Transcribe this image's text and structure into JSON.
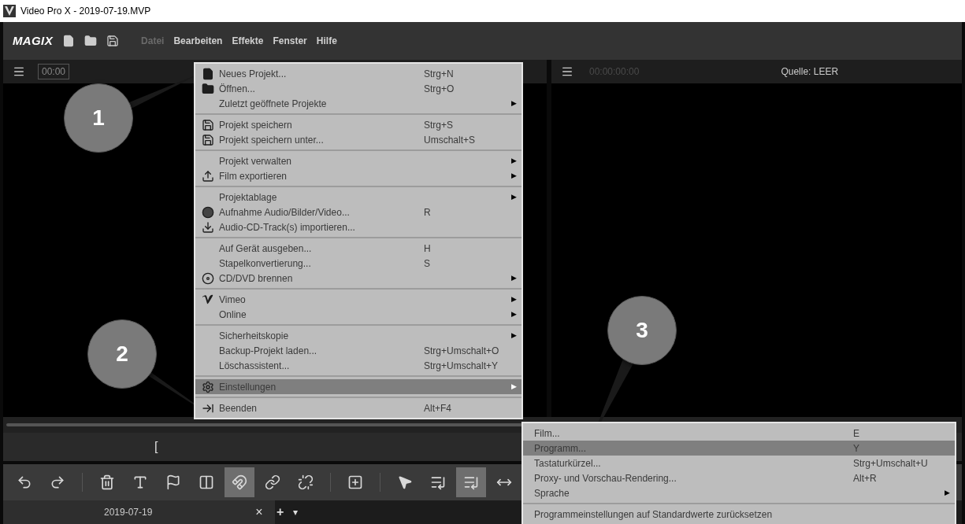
{
  "window": {
    "title": "Video Pro X - 2019-07-19.MVP"
  },
  "app_bar": {
    "logo": "MAGIX",
    "menus": [
      {
        "label": "Datei",
        "selected": true
      },
      {
        "label": "Bearbeiten",
        "selected": false
      },
      {
        "label": "Effekte",
        "selected": false
      },
      {
        "label": "Fenster",
        "selected": false
      },
      {
        "label": "Hilfe",
        "selected": false
      }
    ]
  },
  "left_monitor": {
    "timecode": "00:00"
  },
  "right_monitor": {
    "timecode": "00:00:00:00",
    "source": "Quelle: LEER"
  },
  "in_marker": "[",
  "file_menu": [
    [
      {
        "kind": "file",
        "label": "Neues Projekt...",
        "shortcut": "Strg+N",
        "selected": false
      },
      {
        "kind": "folder",
        "label": "Öffnen...",
        "shortcut": "Strg+O",
        "selected": false
      },
      {
        "kind": "plain",
        "label": "Zuletzt geöffnete Projekte",
        "arrow": "▶",
        "selected": false
      }
    ],
    [
      {
        "kind": "save",
        "label": "Projekt speichern",
        "shortcut": "Strg+S",
        "selected": false
      },
      {
        "kind": "save",
        "label": "Projekt speichern unter...",
        "shortcut": "Umschalt+S",
        "selected": false
      }
    ],
    [
      {
        "kind": "plain",
        "label": "Projekt verwalten",
        "arrow": "▶",
        "selected": false
      },
      {
        "kind": "upload",
        "label": "Film exportieren",
        "arrow": "▶",
        "selected": false
      }
    ],
    [
      {
        "kind": "plain",
        "label": "Projektablage",
        "arrow": "▶",
        "selected": false
      },
      {
        "kind": "record",
        "label": "Aufnahme Audio/Bilder/Video...",
        "shortcut": "R",
        "selected": false
      },
      {
        "kind": "download",
        "label": "Audio-CD-Track(s) importieren...",
        "selected": false
      }
    ],
    [
      {
        "kind": "plain",
        "label": "Auf Gerät ausgeben...",
        "shortcut": "H",
        "selected": false
      },
      {
        "kind": "plain",
        "label": "Stapelkonvertierung...",
        "shortcut": "S",
        "selected": false
      },
      {
        "kind": "disc",
        "label": "CD/DVD brennen",
        "arrow": "▶",
        "selected": false
      }
    ],
    [
      {
        "kind": "vimeo",
        "label": "Vimeo",
        "arrow": "▶",
        "selected": false
      },
      {
        "kind": "plain",
        "label": "Online",
        "arrow": "▶",
        "selected": false
      }
    ],
    [
      {
        "kind": "plain",
        "label": "Sicherheitskopie",
        "arrow": "▶",
        "selected": false
      },
      {
        "kind": "plain",
        "label": "Backup-Projekt laden...",
        "shortcut": "Strg+Umschalt+O",
        "selected": false
      },
      {
        "kind": "plain",
        "label": "Löschassistent...",
        "shortcut": "Strg+Umschalt+Y",
        "selected": false
      }
    ],
    [
      {
        "kind": "gear",
        "label": "Einstellungen",
        "arrow": "▶",
        "selected": true
      }
    ],
    [
      {
        "kind": "exit",
        "label": "Beenden",
        "shortcut": "Alt+F4",
        "selected": false
      }
    ]
  ],
  "settings_submenu": [
    [
      {
        "label": "Film...",
        "shortcut": "E",
        "selected": false
      },
      {
        "label": "Programm...",
        "shortcut": "Y",
        "selected": true
      },
      {
        "label": "Tastaturkürzel...",
        "shortcut": "Strg+Umschalt+U",
        "selected": false
      },
      {
        "label": "Proxy- und Vorschau-Rendering...",
        "shortcut": "Alt+R",
        "selected": false
      },
      {
        "label": "Sprache",
        "arrow": "▶",
        "selected": false
      }
    ],
    [
      {
        "label": "Programmeinstellungen auf Standardwerte zurücksetzen",
        "selected": false
      }
    ]
  ],
  "toolbar": [
    {
      "kind": "undo",
      "selected": false
    },
    {
      "kind": "redo",
      "selected": false
    },
    {
      "kind": "separator"
    },
    {
      "kind": "trash",
      "selected": false
    },
    {
      "kind": "text",
      "selected": false
    },
    {
      "kind": "flag",
      "selected": false
    },
    {
      "kind": "split",
      "selected": false
    },
    {
      "kind": "magnet",
      "selected": true
    },
    {
      "kind": "link",
      "selected": false
    },
    {
      "kind": "unlink",
      "selected": false
    },
    {
      "kind": "separator"
    },
    {
      "kind": "insert",
      "selected": false
    },
    {
      "kind": "separator"
    },
    {
      "kind": "pointer",
      "selected": false
    },
    {
      "kind": "pointer-list",
      "selected": false
    },
    {
      "kind": "pointer-list",
      "selected": true
    },
    {
      "kind": "stretch",
      "selected": false
    }
  ],
  "project_tab": {
    "label": "2019-07-19",
    "close": "×",
    "add": "+",
    "menu": "▾"
  },
  "callouts": [
    {
      "number": "1"
    },
    {
      "number": "2"
    },
    {
      "number": "3"
    }
  ]
}
